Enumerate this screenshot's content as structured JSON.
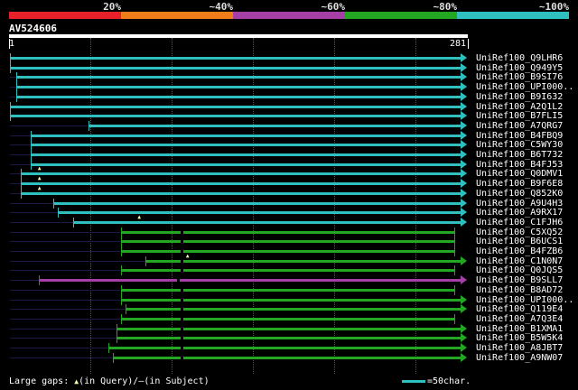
{
  "legend": {
    "labels": [
      "20%",
      "~40%",
      "~60%",
      "~80%",
      "~100%"
    ],
    "colors": [
      "#e8202a",
      "#ef7d1a",
      "#a43fa6",
      "#23a723",
      "#2fbfbf"
    ]
  },
  "query": {
    "id": "AV524606",
    "start": "1",
    "end": "281"
  },
  "hits": [
    {
      "name": "UniRef100_Q9LHR6",
      "start": 1,
      "end": 281,
      "color": "cyan",
      "ins": []
    },
    {
      "name": "UniRef100_Q949Y5",
      "start": 1,
      "end": 281,
      "color": "cyan",
      "ins": []
    },
    {
      "name": "UniRef100_B9SI76",
      "start": 5,
      "end": 281,
      "color": "cyan",
      "ins": []
    },
    {
      "name": "UniRef100_UPI000..",
      "start": 5,
      "end": 281,
      "color": "cyan",
      "ins": []
    },
    {
      "name": "UniRef100_B9I632",
      "start": 5,
      "end": 281,
      "color": "cyan",
      "ins": []
    },
    {
      "name": "UniRef100_A2Q1L2",
      "start": 1,
      "end": 281,
      "color": "cyan",
      "ins": []
    },
    {
      "name": "UniRef100_B7FLI5",
      "start": 1,
      "end": 281,
      "color": "cyan",
      "ins": []
    },
    {
      "name": "UniRef100_A7QRG7",
      "start": 50,
      "end": 281,
      "color": "cyan",
      "ins": []
    },
    {
      "name": "UniRef100_B4FBQ9",
      "start": 14,
      "end": 281,
      "color": "cyan",
      "ins": []
    },
    {
      "name": "UniRef100_C5WY30",
      "start": 14,
      "end": 281,
      "color": "cyan",
      "ins": []
    },
    {
      "name": "UniRef100_B6T732",
      "start": 14,
      "end": 281,
      "color": "cyan",
      "ins": []
    },
    {
      "name": "UniRef100_B4FJ53",
      "start": 14,
      "end": 281,
      "color": "cyan",
      "ins": []
    },
    {
      "name": "UniRef100_Q0DMV1",
      "start": 8,
      "end": 281,
      "color": "cyan",
      "ins": [
        20
      ]
    },
    {
      "name": "UniRef100_B9F6E8",
      "start": 8,
      "end": 281,
      "color": "cyan",
      "ins": [
        20
      ]
    },
    {
      "name": "UniRef100_Q852K0",
      "start": 8,
      "end": 281,
      "color": "cyan",
      "ins": [
        20
      ]
    },
    {
      "name": "UniRef100_A9U4H3",
      "start": 28,
      "end": 281,
      "color": "cyan",
      "ins": []
    },
    {
      "name": "UniRef100_A9RX17",
      "start": 31,
      "end": 281,
      "color": "cyan",
      "ins": []
    },
    {
      "name": "UniRef100_C1FJH6",
      "start": 40,
      "end": 281,
      "color": "cyan",
      "ins": [
        82
      ]
    },
    {
      "name": "UniRef100_C5XQ52",
      "start": 70,
      "end": 277,
      "color": "green",
      "ins": []
    },
    {
      "name": "UniRef100_B6UCS1",
      "start": 70,
      "end": 277,
      "color": "green",
      "ins": []
    },
    {
      "name": "UniRef100_B4FZB6",
      "start": 70,
      "end": 277,
      "color": "green",
      "ins": []
    },
    {
      "name": "UniRef100_C1N0N7",
      "start": 85,
      "end": 281,
      "color": "green",
      "ins": [
        112
      ]
    },
    {
      "name": "UniRef100_Q0JQS5",
      "start": 70,
      "end": 277,
      "color": "green",
      "ins": []
    },
    {
      "name": "UniRef100_B9SLL7",
      "start": 19,
      "end": 281,
      "color": "purple",
      "ins": []
    },
    {
      "name": "UniRef100_B8AD72",
      "start": 70,
      "end": 277,
      "color": "green",
      "ins": []
    },
    {
      "name": "UniRef100_UPI000..",
      "start": 70,
      "end": 281,
      "color": "green",
      "ins": []
    },
    {
      "name": "UniRef100_Q119E4",
      "start": 73,
      "end": 281,
      "color": "green",
      "ins": []
    },
    {
      "name": "UniRef100_A7Q3E4",
      "start": 70,
      "end": 277,
      "color": "green",
      "ins": []
    },
    {
      "name": "UniRef100_B1XMA1",
      "start": 67,
      "end": 281,
      "color": "green",
      "ins": []
    },
    {
      "name": "UniRef100_B5W5K4",
      "start": 67,
      "end": 281,
      "color": "green",
      "ins": []
    },
    {
      "name": "UniRef100_A8JBT7",
      "start": 62,
      "end": 281,
      "color": "green",
      "ins": []
    },
    {
      "name": "UniRef100_A9NW07",
      "start": 65,
      "end": 281,
      "color": "green",
      "ins": []
    }
  ],
  "footer": {
    "gaps_label": "Large gaps:",
    "in_query_symbol": "▲",
    "in_query_text": "(in Query)/",
    "in_subject_symbol": "–",
    "in_subject_text": "(in Subject)",
    "scale_text": "=50char."
  },
  "colors": {
    "cyan": "#2fbfbf",
    "green": "#23a723",
    "purple": "#a43fa6",
    "ruler": "#ffffff",
    "background": "#000000"
  }
}
